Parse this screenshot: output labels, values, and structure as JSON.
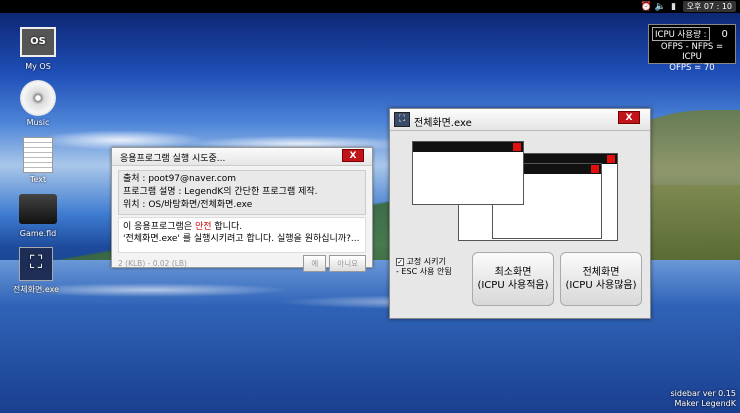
{
  "topbar": {
    "clock": "오후 07 : 10",
    "icons": [
      "alarm-icon",
      "volume-icon",
      "network-icon"
    ]
  },
  "widget": {
    "usage_label": "ICPU 사용량 :",
    "usage_value": "0",
    "line2": "OFPS - NFPS = ICPU",
    "line3": "OFPS = 70"
  },
  "desktop_icons": [
    {
      "label": "My OS",
      "glyph": "OS"
    },
    {
      "label": "Music"
    },
    {
      "label": "Text"
    },
    {
      "label": "Game.fld"
    },
    {
      "label": "전체화면.exe"
    }
  ],
  "dialog1": {
    "title": "응용프로그램 실행 시도중...",
    "close": "X",
    "source": "출처 : poot97@naver.com",
    "desc": "프로그램 설명 : LegendK의 간단한 프로그램 제작.",
    "location": "위치 : OS/바탕화면/전체화면.exe",
    "msg_prefix": "이 응용프로그램은 ",
    "msg_safe": "안전",
    "msg_suffix": " 합니다.",
    "msg_line2": "'전체화면.exe' 를 실행시키려고 합니다. 실행을 원하십니까?...",
    "size": "2 (KLB) - 0.02 (LB)",
    "yes": "예",
    "no": "아니요"
  },
  "dialog2": {
    "title": "전체화면.exe",
    "close": "X",
    "fix_label": "고정 시키기",
    "esc_note": "- ESC 사용 안됨",
    "btn_min_line1": "최소화면",
    "btn_min_line2": "(ICPU 사용적음)",
    "btn_full_line1": "전체화면",
    "btn_full_line2": "(ICPU 사용많음)"
  },
  "credits": {
    "line1": "sidebar ver 0.15",
    "line2": "Maker LegendK"
  }
}
